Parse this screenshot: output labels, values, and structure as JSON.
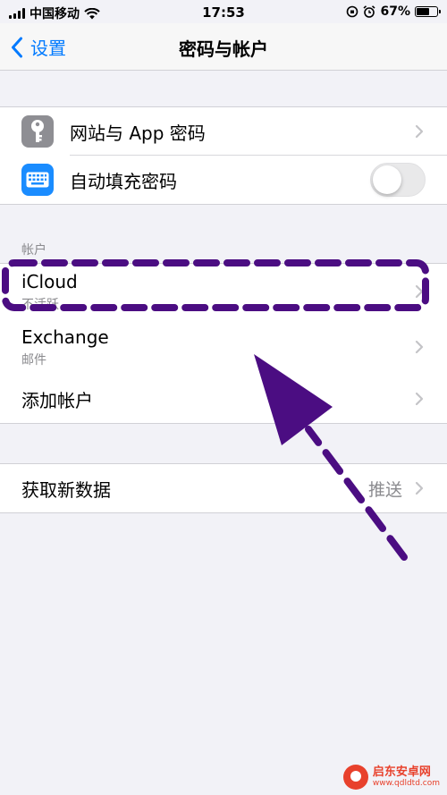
{
  "status_bar": {
    "carrier": "中国移动",
    "time": "17:53",
    "battery_pct": "67%",
    "battery_fraction": 0.67
  },
  "nav": {
    "back_label": "设置",
    "title": "密码与帐户"
  },
  "passwords_group": {
    "website_passwords": {
      "label": "网站与 App 密码",
      "icon": "key-icon"
    },
    "autofill": {
      "label": "自动填充密码",
      "icon": "keyboard-icon",
      "enabled": false
    }
  },
  "accounts_section": {
    "header": "帐户",
    "items": [
      {
        "title": "iCloud",
        "subtitle": "不活跃"
      },
      {
        "title": "Exchange",
        "subtitle": "邮件"
      },
      {
        "title": "添加帐户"
      }
    ]
  },
  "fetch_group": {
    "label": "获取新数据",
    "value": "推送"
  },
  "watermark": {
    "name": "启东安卓网",
    "url": "www.qdldtd.com"
  },
  "colors": {
    "accent": "#007aff",
    "annotation": "#4b0d82",
    "background": "#f2f2f7"
  }
}
